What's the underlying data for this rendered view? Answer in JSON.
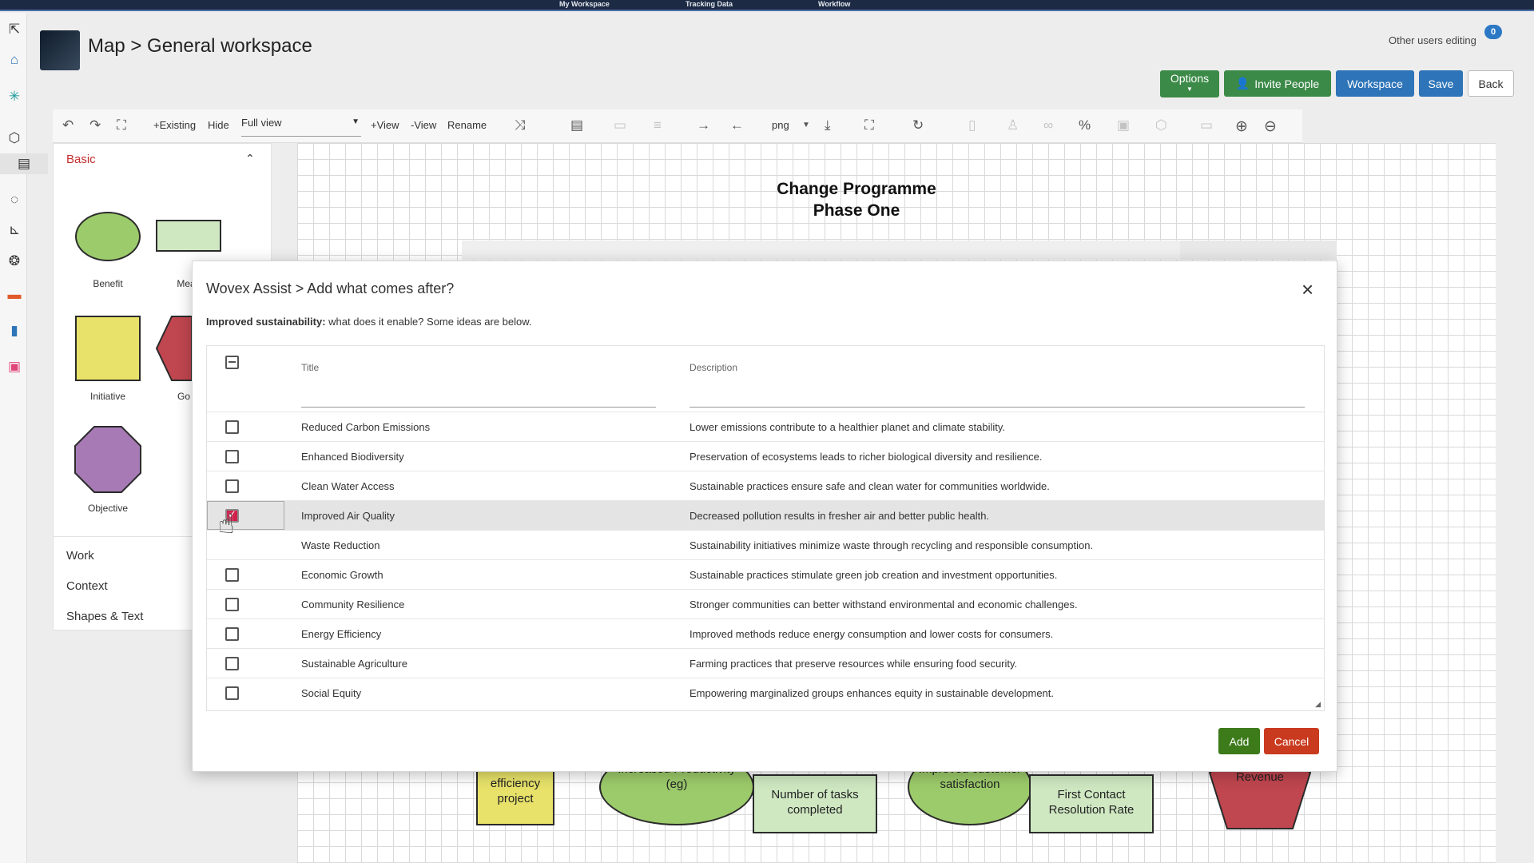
{
  "topnav": {
    "items": [
      "My Workspace",
      "Tracking Data",
      "Workflow"
    ]
  },
  "header": {
    "title": "Map > General workspace",
    "other_users_label": "Other users editing",
    "other_users_count": "0",
    "buttons": {
      "options": "Options",
      "invite": "Invite People",
      "workspace": "Workspace",
      "save": "Save",
      "back": "Back"
    }
  },
  "toolbar": {
    "existing": "+Existing",
    "hide": "Hide",
    "view_select": "Full view",
    "add_view": "+View",
    "remove_view": "-View",
    "rename": "Rename",
    "format": "png",
    "icons": [
      "undo-icon",
      "redo-icon",
      "fit-icon",
      "shuffle-icon",
      "document-icon",
      "card-icon",
      "list-icon",
      "arrow-right-icon",
      "arrow-left-icon",
      "download-icon",
      "fullscreen-icon",
      "share-icon",
      "thermometer-icon",
      "person-icon",
      "link-icon",
      "percent-icon",
      "lock-icon",
      "cube-icon",
      "comment-icon",
      "zoom-in-icon",
      "zoom-out-icon"
    ]
  },
  "palette": {
    "section": "Basic",
    "shapes": [
      {
        "label": "Benefit",
        "color": "#9ccb6b"
      },
      {
        "label": "Meas",
        "color": "#cfe8c2"
      },
      {
        "label": "Initiative",
        "color": "#e8e26a"
      },
      {
        "label": "Go",
        "color": "#c0464f"
      },
      {
        "label": "Objective",
        "color": "#a77ab6"
      }
    ],
    "groups": [
      "Work",
      "Context",
      "Shapes & Text"
    ]
  },
  "canvas": {
    "heading_line1": "Change Programme",
    "heading_line2": "Phase One",
    "nodes": [
      "efficiency project",
      "Increased Productivity (eg)",
      "Number of tasks completed",
      "Improved customer satisfaction",
      "First Contact Resolution Rate",
      "Revenue"
    ]
  },
  "modal": {
    "title": "Wovex Assist > Add what comes after?",
    "subtitle_bold": "Improved sustainability:",
    "subtitle_rest": " what does it enable? Some ideas are below.",
    "columns": {
      "title": "Title",
      "description": "Description"
    },
    "rows": [
      {
        "title": "Reduced Carbon Emissions",
        "description": "Lower emissions contribute to a healthier planet and climate stability.",
        "checked": false
      },
      {
        "title": "Enhanced Biodiversity",
        "description": "Preservation of ecosystems leads to richer biological diversity and resilience.",
        "checked": false
      },
      {
        "title": "Clean Water Access",
        "description": "Sustainable practices ensure safe and clean water for communities worldwide.",
        "checked": false
      },
      {
        "title": "Improved Air Quality",
        "description": "Decreased pollution results in fresher air and better public health.",
        "checked": true
      },
      {
        "title": "Waste Reduction",
        "description": "Sustainability initiatives minimize waste through recycling and responsible consumption.",
        "checked": false
      },
      {
        "title": "Economic Growth",
        "description": "Sustainable practices stimulate green job creation and investment opportunities.",
        "checked": false
      },
      {
        "title": "Community Resilience",
        "description": "Stronger communities can better withstand environmental and economic challenges.",
        "checked": false
      },
      {
        "title": "Energy Efficiency",
        "description": "Improved methods reduce energy consumption and lower costs for consumers.",
        "checked": false
      },
      {
        "title": "Sustainable Agriculture",
        "description": "Farming practices that preserve resources while ensuring food security.",
        "checked": false
      },
      {
        "title": "Social Equity",
        "description": "Empowering marginalized groups enhances equity in sustainable development.",
        "checked": false
      }
    ],
    "add": "Add",
    "cancel": "Cancel"
  },
  "colors": {
    "accent_green": "#3c8a48",
    "accent_blue": "#2d74b8",
    "cancel_red": "#c93a1f",
    "add_green": "#3c7a1a",
    "checkbox_checked": "#d21f4b"
  }
}
